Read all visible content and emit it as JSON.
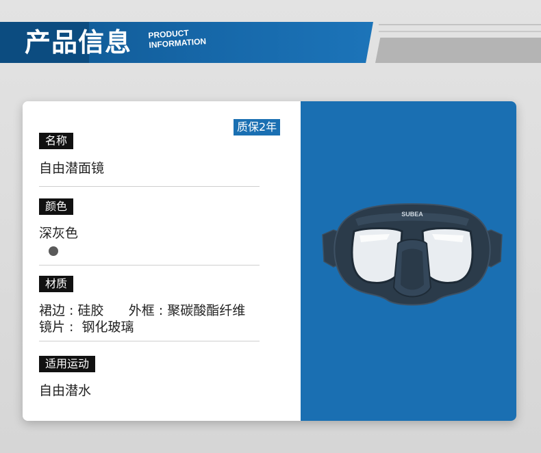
{
  "header": {
    "title": "产品信息",
    "subtitle_line1": "PRODUCT",
    "subtitle_line2": "INFORMATION",
    "brand_color": "#1667a8"
  },
  "warranty_badge": "质保2年",
  "specs": {
    "name": {
      "label": "名称",
      "value": "自由潜面镜"
    },
    "color": {
      "label": "颜色",
      "value": "深灰色",
      "swatch_color": "#5a5a5a"
    },
    "material": {
      "label": "材质",
      "line1": "裙边 : 硅胶      外框 : 聚碳酸酯纤维",
      "line2": "镜片 :  钢化玻璃"
    },
    "sport": {
      "label": "适用运动",
      "value": "自由潜水"
    }
  },
  "product_image": {
    "icon": "dive-mask-icon",
    "brand_text": "SUBEA",
    "background_color": "#1a6fb2"
  }
}
